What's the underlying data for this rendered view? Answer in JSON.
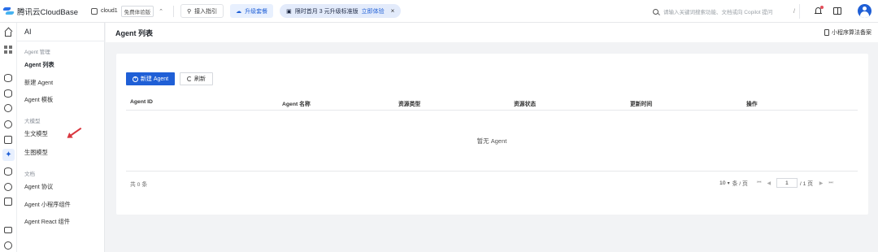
{
  "topbar": {
    "brand": "腾讯云CloudBase",
    "env_name": "cloud1",
    "env_plan": "免费体验版",
    "guide_label": "接入指引",
    "upgrade_label": "升级套餐",
    "promo_text": "限时首月 3 元升级标准版",
    "promo_link": "立即体验",
    "promo_close": "×",
    "search_placeholder": "请输入关键词搜索功能、文档或向 Copilot 提问",
    "search_shortcut": "/"
  },
  "nav": {
    "title": "AI",
    "groups": [
      {
        "label": "Agent 管理",
        "items": [
          "Agent 列表",
          "新建 Agent",
          "Agent 模板"
        ]
      },
      {
        "label": "大模型",
        "items": [
          "生文模型",
          "生图模型"
        ]
      },
      {
        "label": "文档",
        "items": [
          "Agent 协议",
          "Agent 小程序组件",
          "Agent React 组件"
        ]
      }
    ],
    "active_item": "Agent 列表"
  },
  "page": {
    "title": "Agent 列表",
    "filing_label": "小程序算法备案"
  },
  "toolbar": {
    "new_label": "新建 Agent",
    "refresh_label": "刷新"
  },
  "table": {
    "columns": [
      "Agent ID",
      "Agent 名称",
      "资源类型",
      "资源状态",
      "更新时间",
      "操作"
    ],
    "rows": [],
    "empty_text": "暂无 Agent"
  },
  "pagination": {
    "total": "共 0 条",
    "page_size": "10",
    "page_size_unit": "条 / 页",
    "current_page": "1",
    "total_pages": "/ 1 页"
  },
  "colors": {
    "primary": "#1f5fd6",
    "promo_bg": "#e3ebfb",
    "annotation_arrow": "#d9363e"
  },
  "icons": [
    "home-icon",
    "dashboard-icon",
    "database-icon",
    "storage-icon",
    "function-icon",
    "cloud-run-icon",
    "hosting-icon",
    "ai-icon",
    "extension-icon",
    "user-icon",
    "integration-icon",
    "monitor-icon",
    "rocket-icon"
  ]
}
